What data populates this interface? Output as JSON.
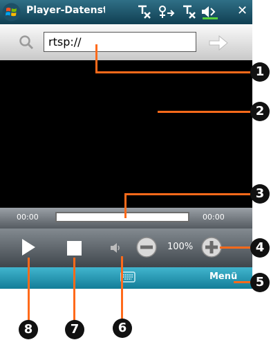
{
  "titlebar": {
    "title": "Player-Datenstrom",
    "close_glyph": "✕",
    "bg": "#1a5570"
  },
  "status_icons": [
    "antenna-off-icon",
    "connectivity-icon",
    "signal-off-icon",
    "volume-icon"
  ],
  "urlbar": {
    "value": "rtsp://",
    "search_icon": "search-icon",
    "go_icon": "arrow-right-icon"
  },
  "playback": {
    "time_elapsed": "00:00",
    "time_total": "00:00",
    "progress": 0
  },
  "controls": {
    "volume": "100%",
    "play_icon": "play-icon",
    "stop_icon": "stop-icon",
    "mute_icon": "speaker-icon",
    "decrease_icon": "minus-icon",
    "increase_icon": "plus-icon"
  },
  "menubar": {
    "menu_label": "Menü",
    "keyboard_icon": "keyboard-icon"
  },
  "callouts": [
    "1",
    "2",
    "3",
    "4",
    "5",
    "6",
    "7",
    "8"
  ],
  "colors": {
    "callout_line": "#ff6a1a",
    "menubar": "#2a9cb8",
    "video": "#000000"
  }
}
